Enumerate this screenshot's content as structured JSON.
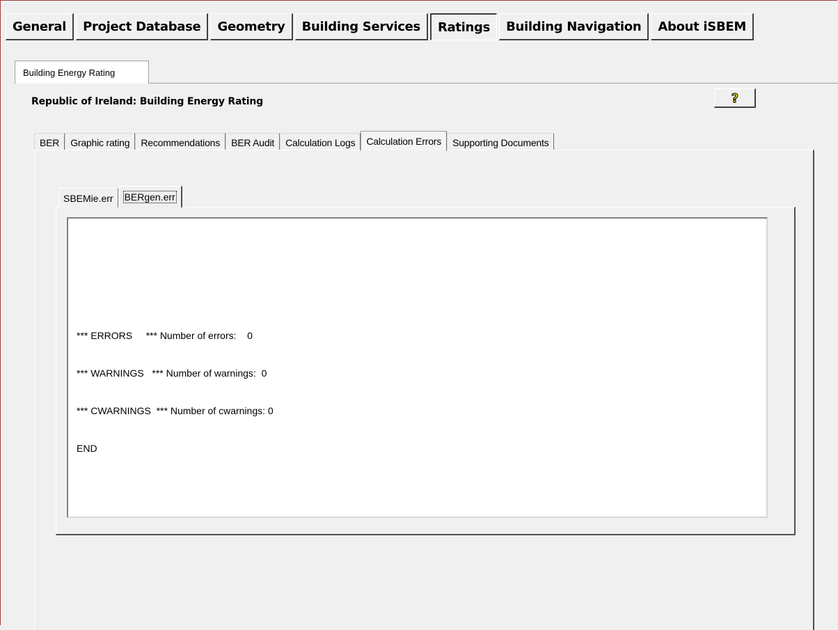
{
  "main_tabs": [
    {
      "label": "General",
      "active": false
    },
    {
      "label": "Project Database",
      "active": false
    },
    {
      "label": "Geometry",
      "active": false
    },
    {
      "label": "Building Services",
      "active": false
    },
    {
      "label": "Ratings",
      "active": true
    },
    {
      "label": "Building Navigation",
      "active": false
    },
    {
      "label": "About iSBEM",
      "active": false
    }
  ],
  "sub_tab": {
    "label": "Building Energy Rating"
  },
  "section_title": "Republic of Ireland: Building Energy Rating",
  "help_button": {
    "icon": "help-question-icon",
    "glyph": "?"
  },
  "inner_tabs": [
    {
      "label": "BER",
      "active": false
    },
    {
      "label": "Graphic rating",
      "active": false
    },
    {
      "label": "Recommendations",
      "active": false
    },
    {
      "label": "BER Audit",
      "active": false
    },
    {
      "label": "Calculation Logs",
      "active": false
    },
    {
      "label": "Calculation Errors",
      "active": true
    },
    {
      "label": "Supporting Documents",
      "active": false
    }
  ],
  "file_tabs": [
    {
      "label": "SBEMie.err",
      "active": false
    },
    {
      "label": "BERgen.err",
      "active": true
    }
  ],
  "log_lines": [
    "*** ERRORS     *** Number of errors:    0",
    "*** WARNINGS   *** Number of warnings:  0",
    "*** CWARNINGS  *** Number of cwarnings: 0",
    "END"
  ],
  "colors": {
    "background": "#f0f0f0",
    "text_area": "#ffffff",
    "help_icon": "#e8d200",
    "frame_border": "#a33a3a"
  }
}
